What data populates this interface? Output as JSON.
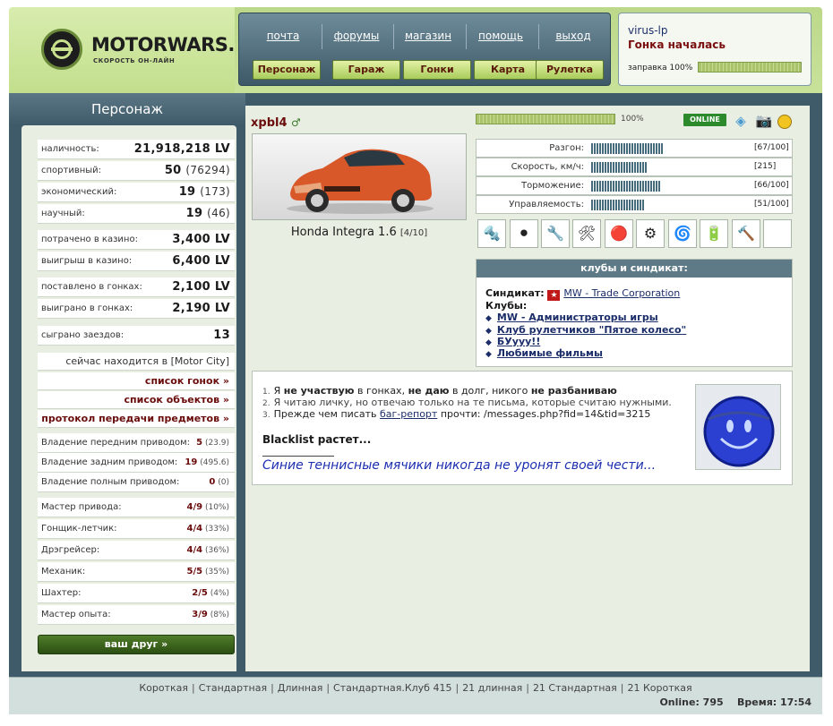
{
  "logo": {
    "title": "MOTORWARS.RU",
    "subtitle": "СКОРОСТЬ ОН-ЛАЙН"
  },
  "top_nav": [
    "почта",
    "форумы",
    "магазин",
    "помощь",
    "выход"
  ],
  "main_nav": [
    "Персонаж",
    "Гараж",
    "Гонки",
    "Карта",
    "Рулетка"
  ],
  "user": {
    "name": "virus-lp",
    "status": "Гонка началась",
    "fuel_label": "заправка 100%",
    "fuel_percent": 100
  },
  "left": {
    "title": "Персонаж",
    "stats": [
      {
        "label": "наличность:",
        "value": "21,918,218 LV",
        "sub": ""
      },
      {
        "label": "спортивный:",
        "value": "50",
        "sub": "(76294)"
      },
      {
        "label": "экономический:",
        "value": "19",
        "sub": "(173)"
      },
      {
        "label": "научный:",
        "value": "19",
        "sub": "(46)"
      },
      {
        "label": "потрачено в казино:",
        "value": "3,400 LV",
        "sub": ""
      },
      {
        "label": "выигрыш в казино:",
        "value": "6,400 LV",
        "sub": ""
      },
      {
        "label": "поставлено в гонках:",
        "value": "2,100 LV",
        "sub": ""
      },
      {
        "label": "выиграно в гонках:",
        "value": "2,190 LV",
        "sub": ""
      },
      {
        "label": "сыграно заездов:",
        "value": "13",
        "sub": ""
      }
    ],
    "location": "сейчас находится в [Motor City]",
    "links": [
      "список гонок »",
      "список объектов »",
      "протокол передачи предметов »"
    ],
    "drives": [
      {
        "label": "Владение передним приводом:",
        "value": "5",
        "sub": "(23.9)"
      },
      {
        "label": "Владение задним приводом:",
        "value": "19",
        "sub": "(495.6)"
      },
      {
        "label": "Владение полным приводом:",
        "value": "0",
        "sub": "(0)"
      }
    ],
    "skills": [
      {
        "label": "Мастер привода:",
        "value": "4/9",
        "sub": "(10%)"
      },
      {
        "label": "Гонщик-летчик:",
        "value": "4/4",
        "sub": "(33%)"
      },
      {
        "label": "Дрэгрейсер:",
        "value": "4/4",
        "sub": "(36%)"
      },
      {
        "label": "Механик:",
        "value": "5/5",
        "sub": "(35%)"
      },
      {
        "label": "Шахтер:",
        "value": "2/5",
        "sub": "(4%)"
      },
      {
        "label": "Мастер опыта:",
        "value": "3/9",
        "sub": "(8%)"
      }
    ],
    "friend_button": "ваш друг »"
  },
  "profile": {
    "nickname": "xpbl4",
    "gender_icon": "♂",
    "car_model": "Honda Integra 1.6",
    "car_grade": "[4/10]",
    "hp_label": "100%",
    "hp_percent": 100,
    "online_badge": "ONLINE",
    "icons": [
      "diamond-icon",
      "camera-icon",
      "coin-icon"
    ]
  },
  "specs": [
    {
      "label": "Разгон:",
      "value": "[67/100]",
      "percent": 67
    },
    {
      "label": "Скорость, км/ч:",
      "value": "[215]",
      "percent": 50
    },
    {
      "label": "Торможение:",
      "value": "[66/100]",
      "percent": 66
    },
    {
      "label": "Управляемость:",
      "value": "[51/100]",
      "percent": 51
    }
  ],
  "parts": [
    "suspension-icon",
    "tire-icon",
    "exhaust-icon",
    "brake-icon",
    "brake-disc-icon",
    "gear-icon",
    "turbo-icon",
    "engine-icon",
    "tool-icon",
    "empty-slot"
  ],
  "clubs": {
    "heading": "клубы и синдикат:",
    "syndicate_label": "Синдикат:",
    "syndicate_name": "MW - Trade Corporation",
    "clubs_label": "Клубы:",
    "items": [
      "MW - Администраторы игры",
      "Клуб рулетчиков \"Пятое колесо\"",
      "БУууу!!",
      "Любимые фильмы"
    ]
  },
  "about": {
    "rule1": {
      "num": "1.",
      "parts": [
        "Я ",
        "не участвую",
        " в гонках, ",
        "не даю",
        " в долг, никого ",
        "не разбаниваю"
      ]
    },
    "rule2": {
      "num": "2.",
      "text": "Я читаю личку, но отвечаю только на те письма, которые считаю нужными."
    },
    "rule3": {
      "num": "3.",
      "prefix": "Прежде чем писать ",
      "link": "баг-репорт",
      "suffix": " прочти: /messages.php?fid=14&tid=3215"
    },
    "blacklist": "Blacklist растет...",
    "signature": "Синие теннисные мячики никогда не уронят своей чести..."
  },
  "footer": {
    "tracks": [
      "Короткая",
      "Стандартная",
      "Длинная",
      "Стандартная.Клуб 415",
      "21 длинная",
      "21 Стандартная",
      "21 Короткая"
    ],
    "online": "Online: 795",
    "time": "Время: 17:54"
  }
}
